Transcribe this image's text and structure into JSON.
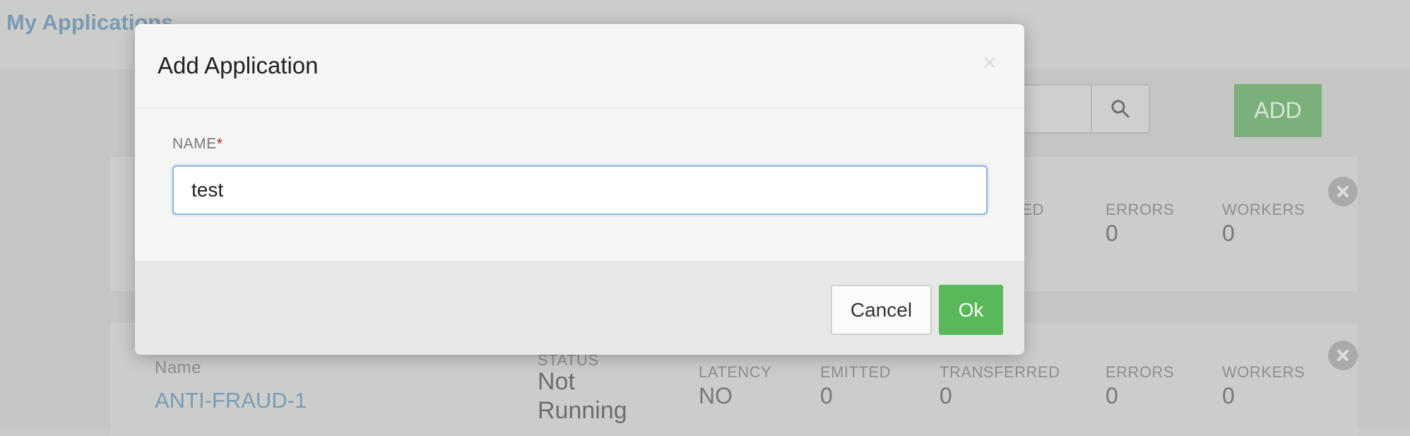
{
  "page": {
    "title": "My Applications",
    "add_label": "ADD",
    "search_icon": "search-icon"
  },
  "apps": [
    {
      "labels": {
        "transferred_partial": "RED",
        "errors": "ERRORS",
        "workers": "WORKERS"
      },
      "values": {
        "errors": "0",
        "workers": "0"
      }
    },
    {
      "name_label": "Name",
      "name": "ANTI-FRAUD-1",
      "labels": {
        "status": "STATUS",
        "latency": "LATENCY",
        "emitted": "EMITTED",
        "transferred": "TRANSFERRED",
        "errors": "ERRORS",
        "workers": "WORKERS"
      },
      "values": {
        "status_line1": "Not",
        "status_line2": "Running",
        "latency": "NO",
        "emitted": "0",
        "transferred": "0",
        "errors": "0",
        "workers": "0"
      }
    }
  ],
  "modal": {
    "title": "Add Application",
    "close_symbol": "×",
    "field_label": "NAME",
    "required_mark": "*",
    "name_value": "test",
    "cancel_label": "Cancel",
    "ok_label": "Ok"
  },
  "colors": {
    "ok_green": "#58b85a",
    "add_green": "#7bb07a",
    "link_blue": "#7d9ab4",
    "required_red": "#b02030"
  }
}
